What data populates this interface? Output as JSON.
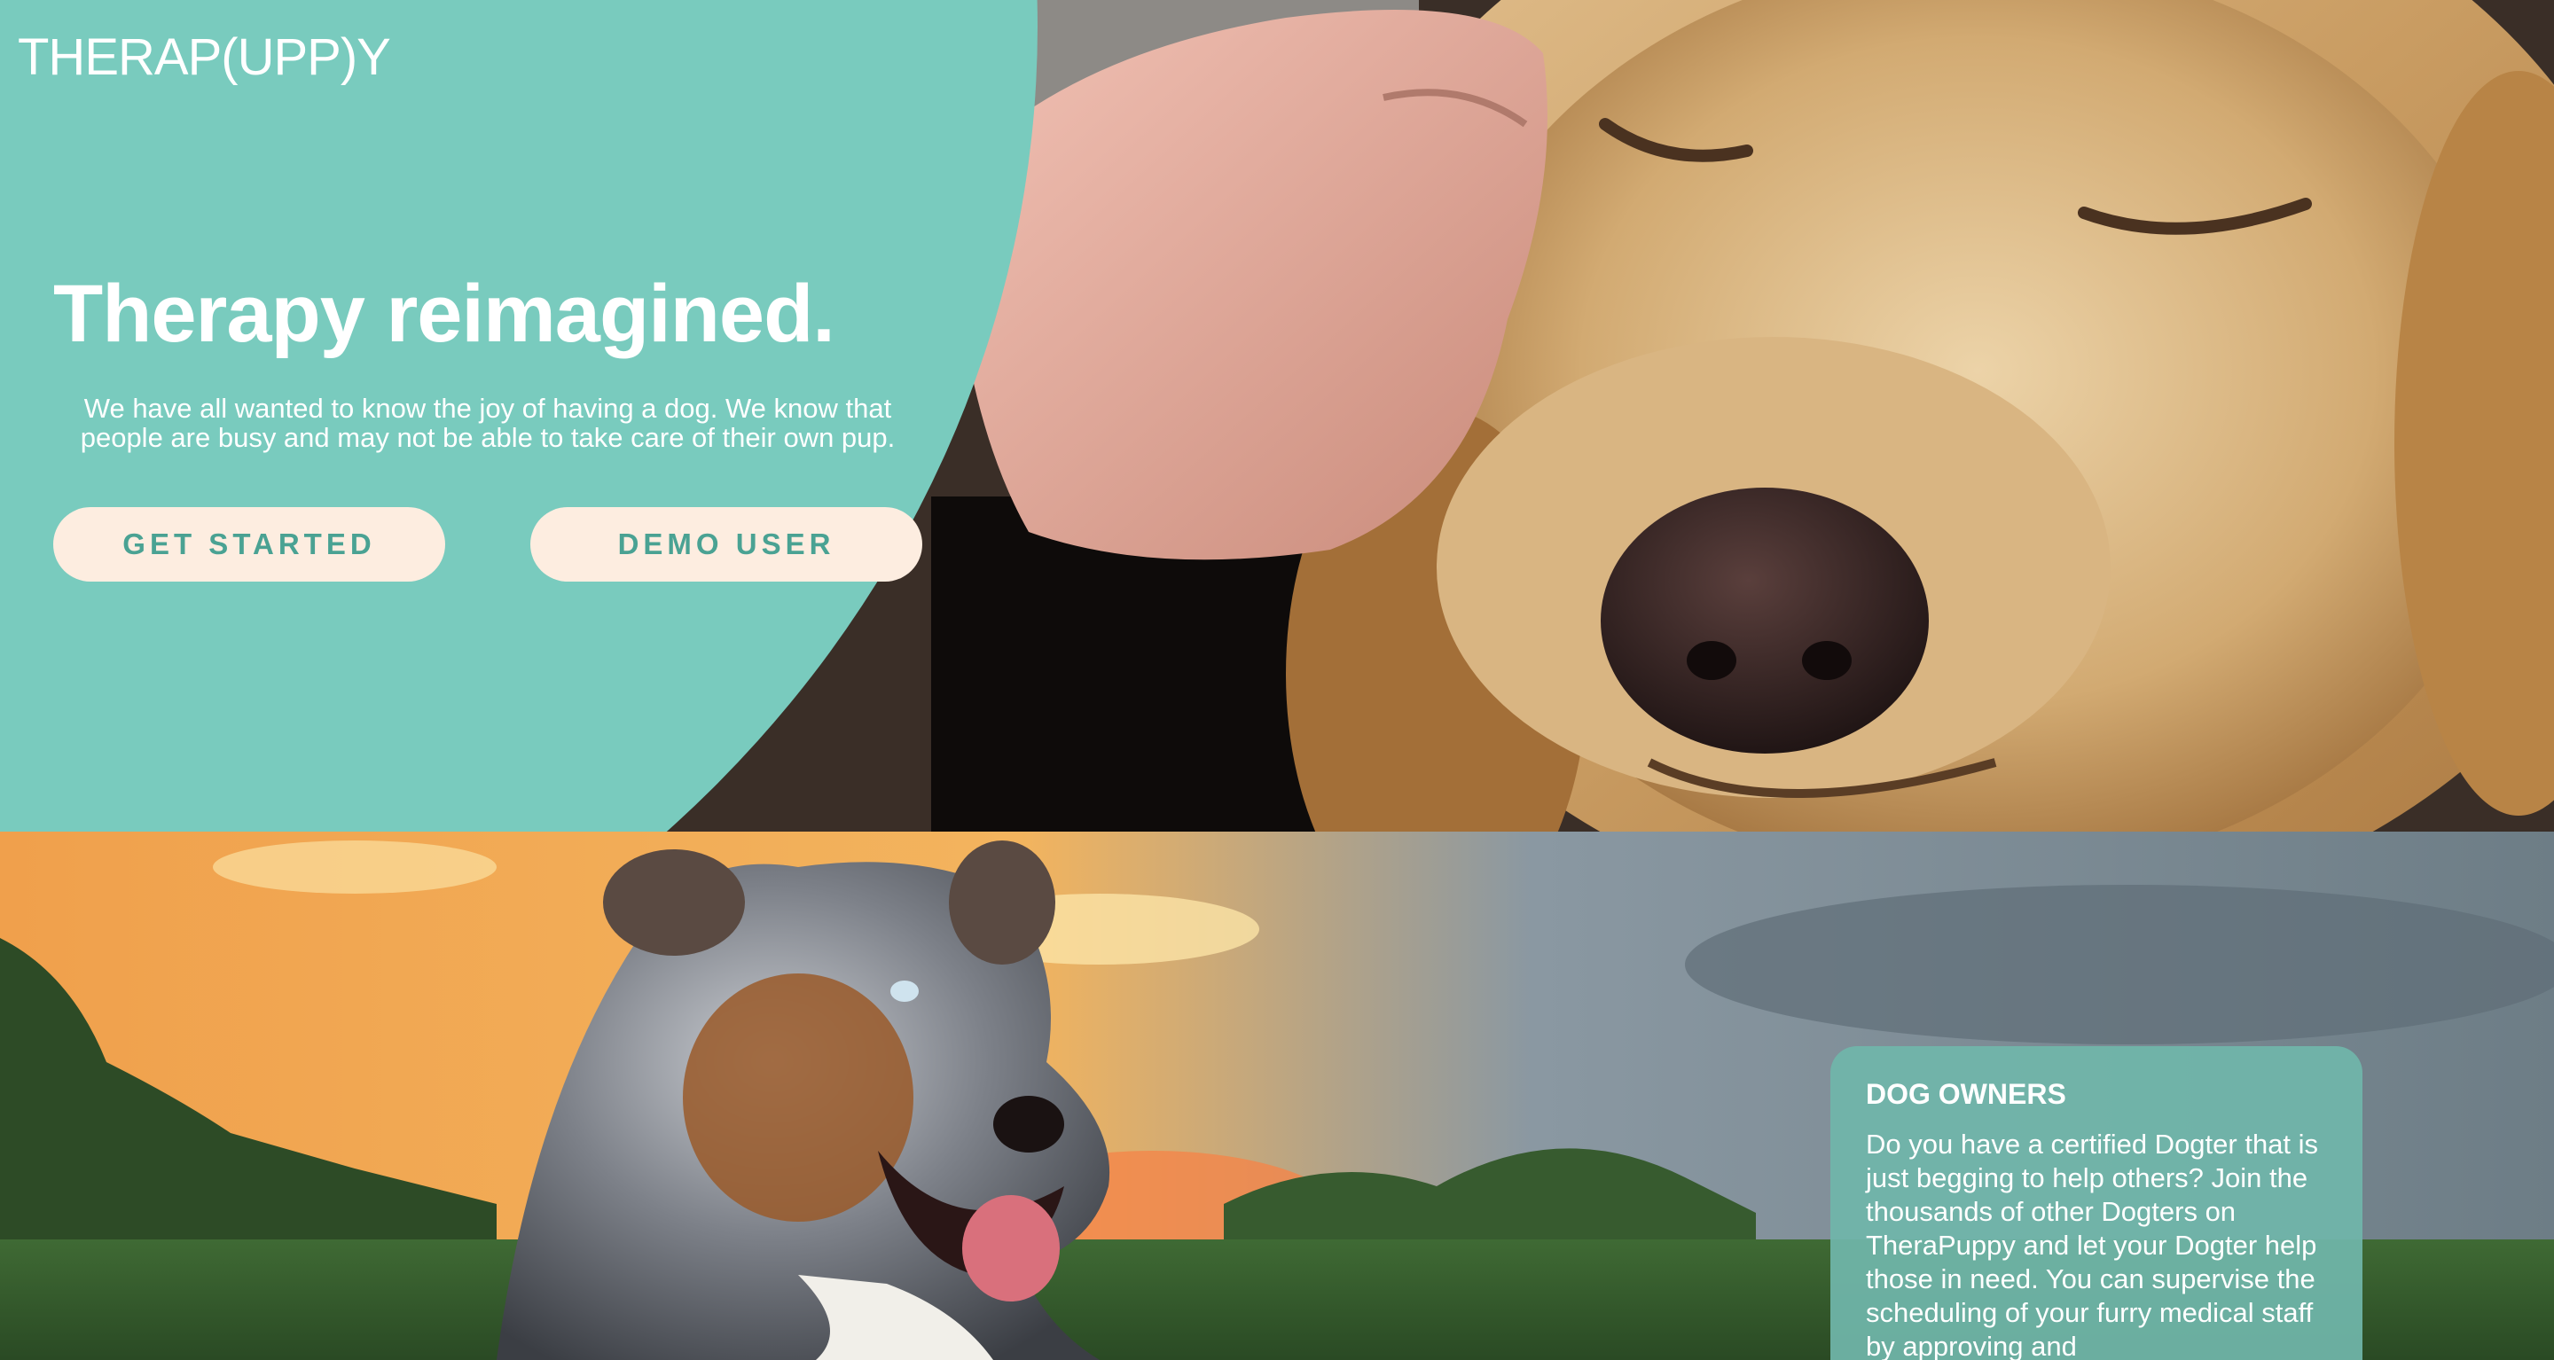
{
  "brand": {
    "logo_text": "THERAP(UPP)Y"
  },
  "hero": {
    "title": "Therapy reimagined.",
    "description": "We have all wanted to know the joy of having a dog. We know that people are busy and may not be able to take care of their own pup.",
    "buttons": {
      "get_started": "GET STARTED",
      "demo_user": "DEMO USER"
    },
    "photo_description": "close-up of a golden retriever with eyes closed being petted by a hand"
  },
  "owners_section": {
    "title": "DOG OWNERS",
    "body": "Do you have a certified Dogter that is just begging to help others? Join the thousands of other Dogters on TheraPuppy and let your Dogter help those in need. You can supervise the scheduling of your furry medical staff by approving and",
    "photo_description": "australian shepherd dog at sunset in a field"
  },
  "colors": {
    "primary_teal": "#79cbbe",
    "button_bg": "#fdede0",
    "button_text": "#4aa293",
    "card_bg": "#70b6aa",
    "text_white": "#ffffff"
  }
}
